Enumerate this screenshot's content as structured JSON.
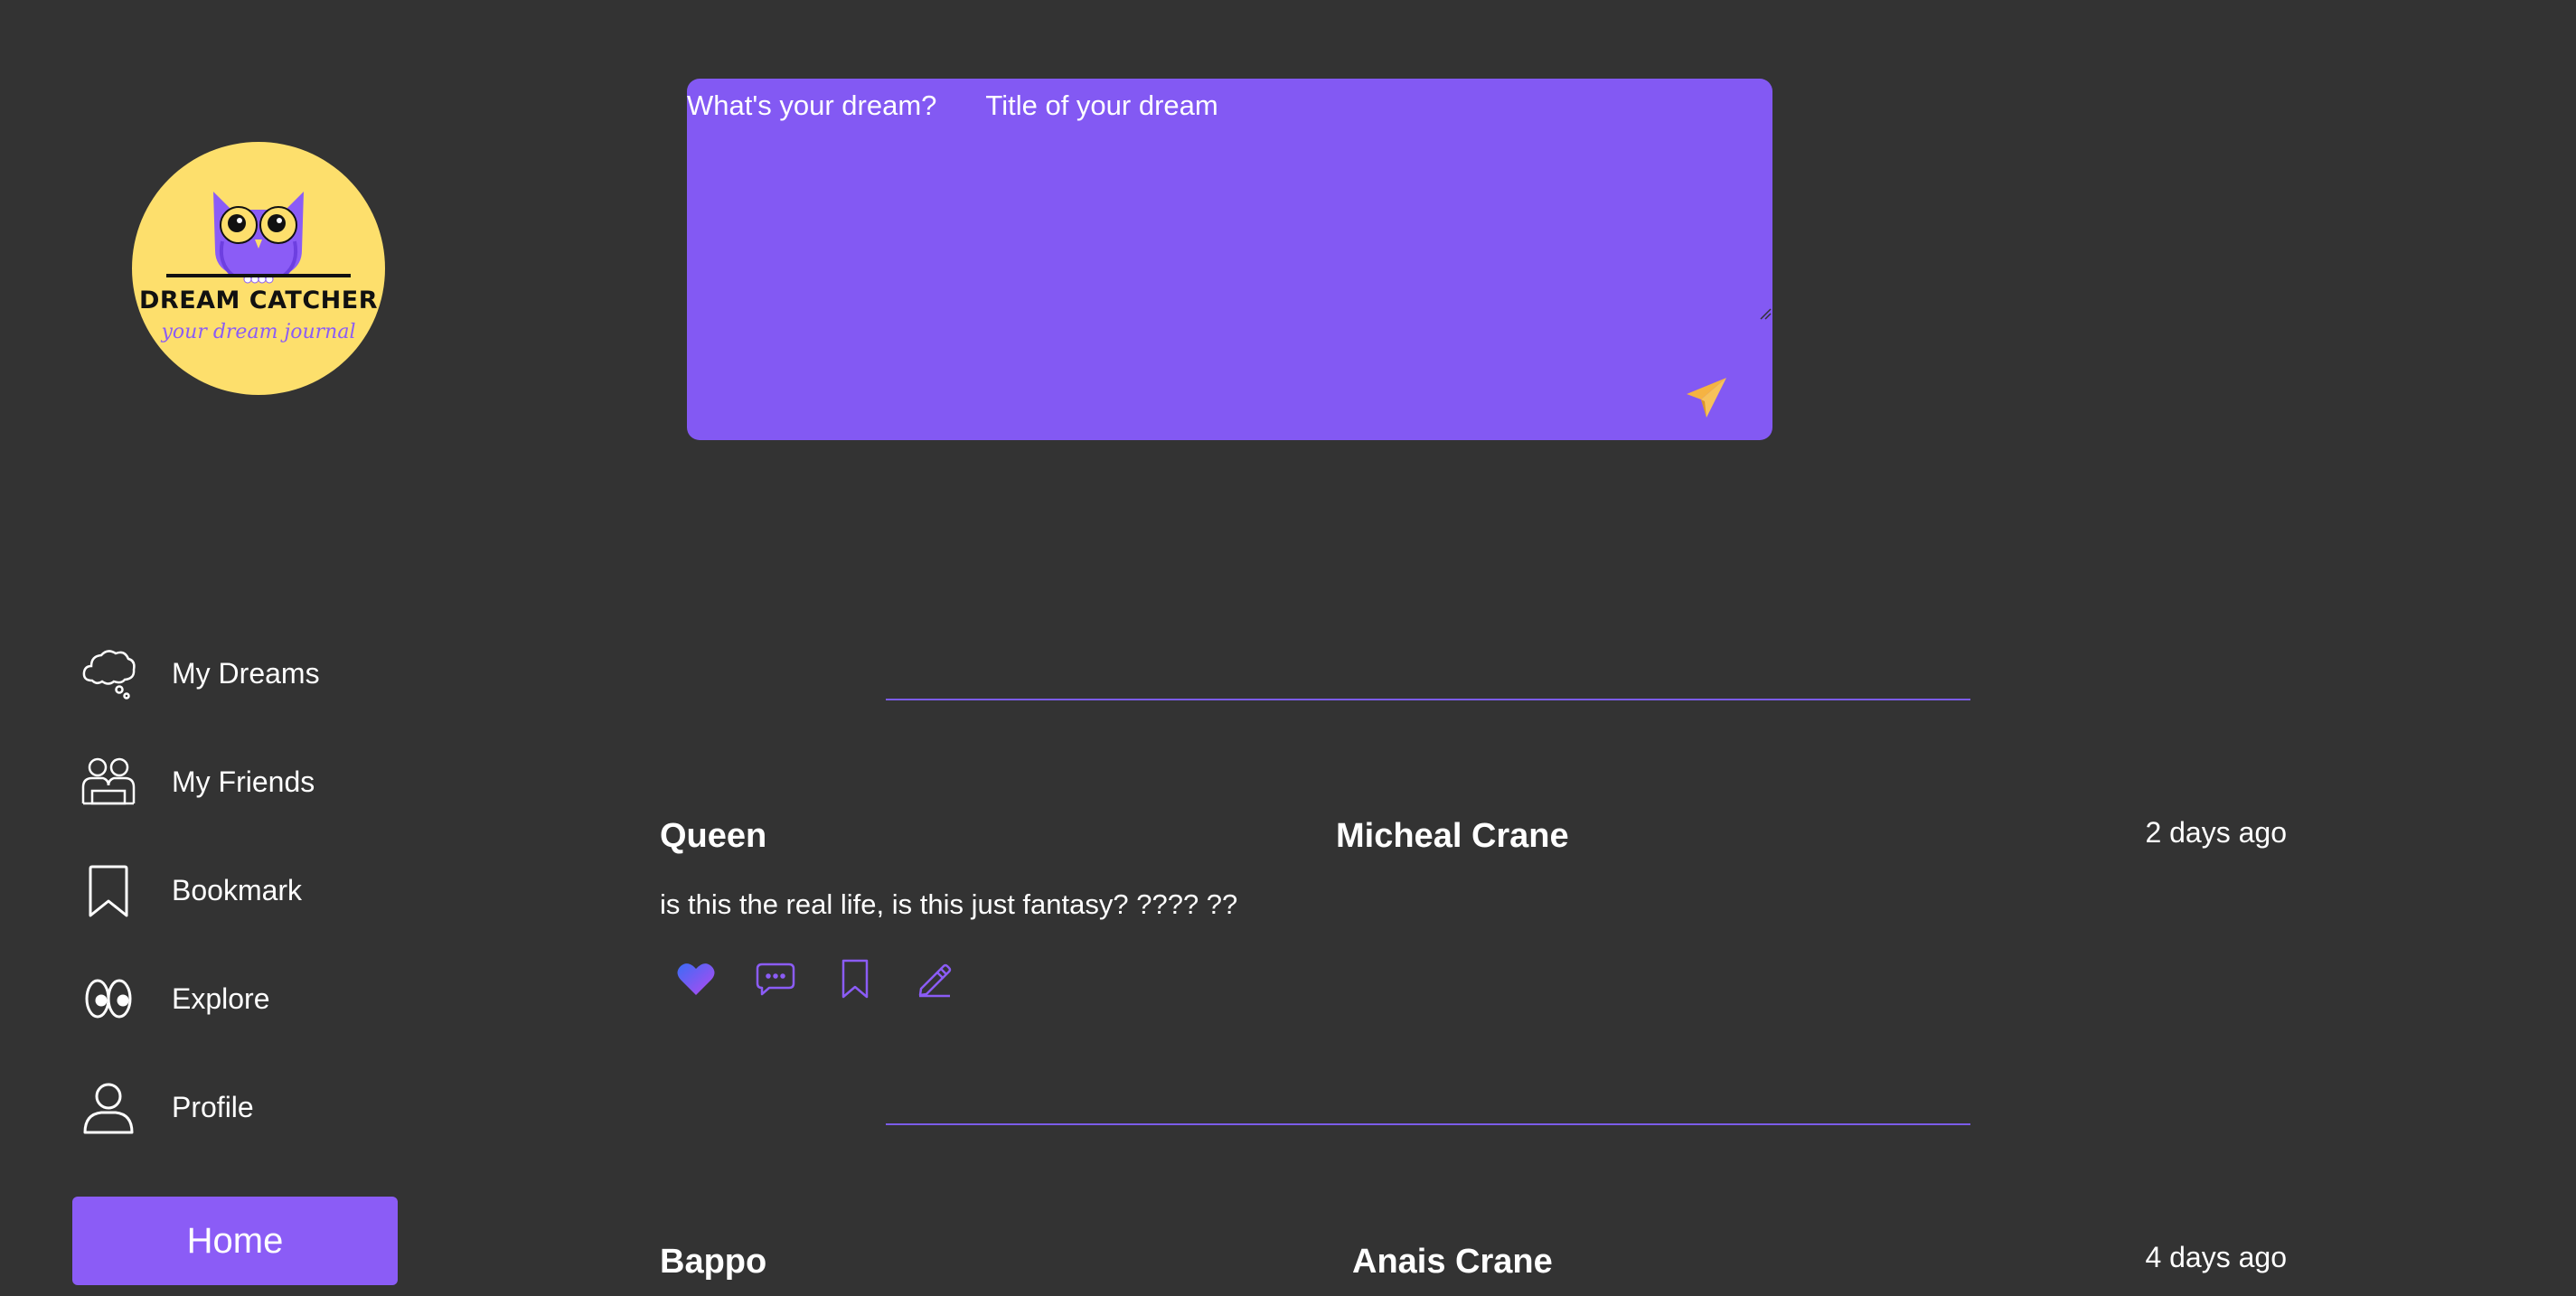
{
  "logo": {
    "title": "DREAM CATCHER",
    "subtitle": "your dream journal",
    "icon": "owl-logo"
  },
  "sidebar": {
    "items": [
      {
        "label": "My Dreams",
        "icon": "thought-cloud-icon"
      },
      {
        "label": "My Friends",
        "icon": "friends-icon"
      },
      {
        "label": "Bookmark",
        "icon": "bookmark-icon"
      },
      {
        "label": "Explore",
        "icon": "eyes-icon"
      },
      {
        "label": "Profile",
        "icon": "user-icon"
      }
    ],
    "home_label": "Home"
  },
  "composer": {
    "dream_label": "What's your dream?",
    "title_placeholder": "Title of your dream",
    "send_icon": "paper-plane-icon"
  },
  "posts": [
    {
      "title": "Queen",
      "author": "Micheal Crane",
      "time": "2 days ago",
      "text": "is this the real life, is this just fantasy? ???? ??"
    },
    {
      "title": "Bappo",
      "author": "Anais Crane",
      "time": "4 days ago"
    }
  ],
  "colors": {
    "background": "#333333",
    "accent": "#8b5cf6",
    "composer": "#8359f3",
    "logo_bg": "#fddf6c",
    "send": "#f5b342"
  }
}
